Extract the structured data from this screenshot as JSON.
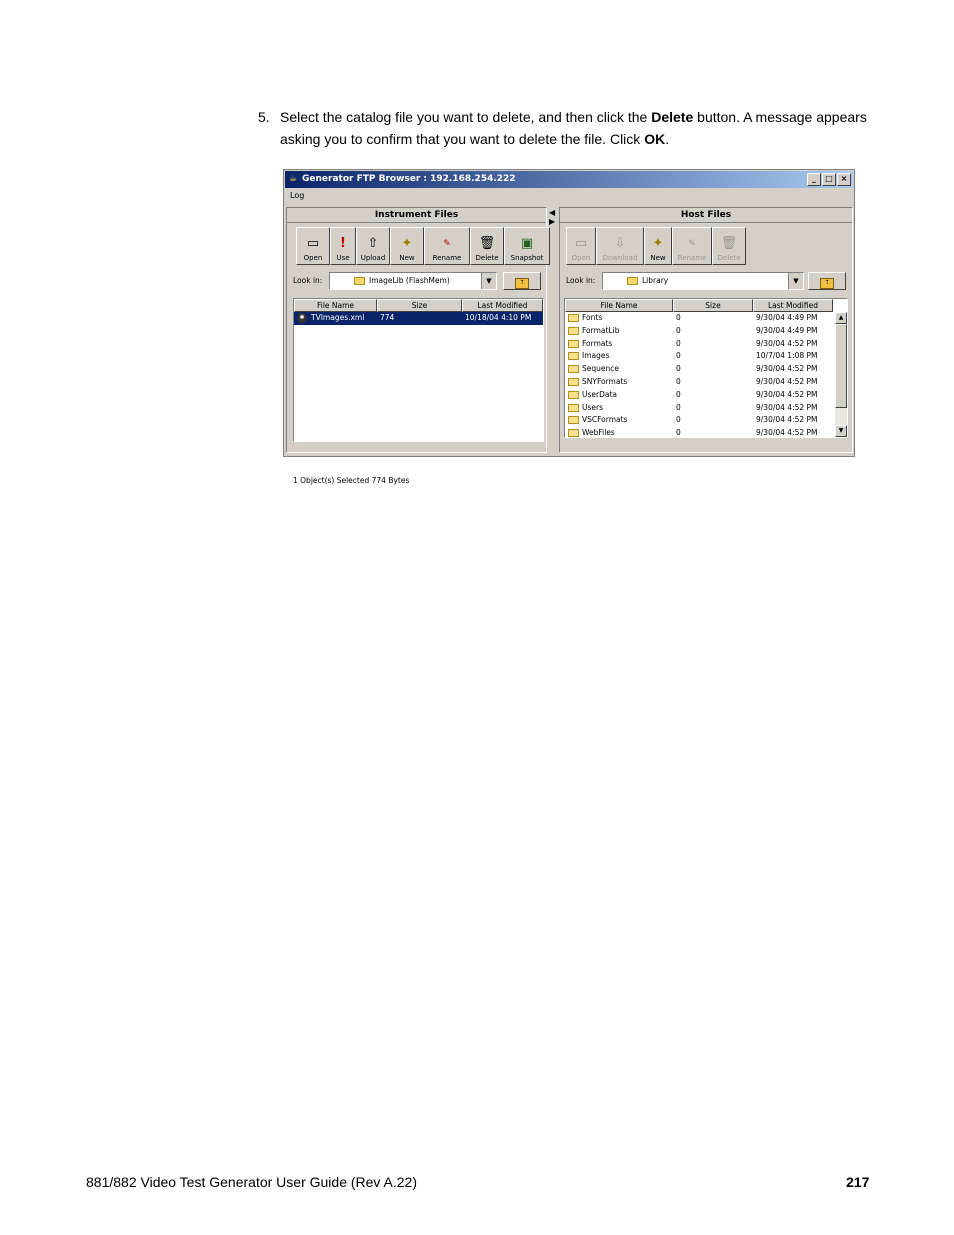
{
  "step": {
    "number": "5.",
    "text_1": "Select the catalog file you want to delete, and then click the ",
    "bold_1": "Delete",
    "text_2": " button. A message appears asking you to confirm that you want to delete the file. Click ",
    "bold_2": "OK",
    "text_3": "."
  },
  "window": {
    "title": "Generator FTP Browser : 192.168.254.222",
    "menu": "Log",
    "buttons": [
      "_",
      "□",
      "×"
    ]
  },
  "instrument": {
    "title": "Instrument Files",
    "toolbar": [
      {
        "label": "Open",
        "icon": "open-icon"
      },
      {
        "label": "Use",
        "icon": "use-icon"
      },
      {
        "label": "Upload",
        "icon": "upload-icon"
      },
      {
        "label": "New",
        "icon": "new-icon"
      },
      {
        "label": "Rename",
        "icon": "rename-icon"
      },
      {
        "label": "Delete",
        "icon": "delete-icon"
      },
      {
        "label": "Snapshot",
        "icon": "snapshot-icon"
      }
    ],
    "look_in_label": "Look in:",
    "look_in_value": "ImageLib   (FlashMem)",
    "columns": [
      "File Name",
      "Size",
      "Last Modified"
    ],
    "rows": [
      {
        "name": "TVImages.xml",
        "size": "774",
        "modified": "10/18/04 4:10 PM"
      }
    ],
    "status": "1 Object(s) Selected   774 Bytes"
  },
  "host": {
    "title": "Host Files",
    "toolbar": [
      {
        "label": "Open",
        "icon": "open-icon",
        "disabled": true
      },
      {
        "label": "Download",
        "icon": "download-icon",
        "disabled": true
      },
      {
        "label": "New",
        "icon": "new-icon",
        "disabled": false
      },
      {
        "label": "Rename",
        "icon": "rename-icon",
        "disabled": true
      },
      {
        "label": "Delete",
        "icon": "delete-icon",
        "disabled": true
      }
    ],
    "look_in_label": "Look in:",
    "look_in_value": "Library",
    "columns": [
      "File Name",
      "Size",
      "Last Modified"
    ],
    "rows": [
      {
        "name": "Fonts",
        "size": "0",
        "modified": "9/30/04 4:49 PM"
      },
      {
        "name": "FormatLib",
        "size": "0",
        "modified": "9/30/04 4:49 PM"
      },
      {
        "name": "Formats",
        "size": "0",
        "modified": "9/30/04 4:52 PM"
      },
      {
        "name": "Images",
        "size": "0",
        "modified": "10/7/04 1:08 PM"
      },
      {
        "name": "Sequence",
        "size": "0",
        "modified": "9/30/04 4:52 PM"
      },
      {
        "name": "SNYFormats",
        "size": "0",
        "modified": "9/30/04 4:52 PM"
      },
      {
        "name": "UserData",
        "size": "0",
        "modified": "9/30/04 4:52 PM"
      },
      {
        "name": "Users",
        "size": "0",
        "modified": "9/30/04 4:52 PM"
      },
      {
        "name": "VSCFormats",
        "size": "0",
        "modified": "9/30/04 4:52 PM"
      },
      {
        "name": "WebFiles",
        "size": "0",
        "modified": "9/30/04 4:52 PM"
      }
    ]
  },
  "footer": {
    "left": "881/882 Video Test Generator User Guide (Rev A.22)",
    "page": "217"
  }
}
